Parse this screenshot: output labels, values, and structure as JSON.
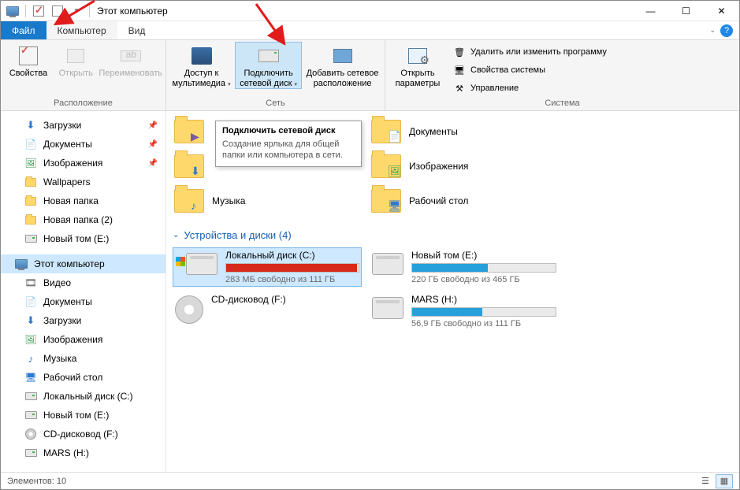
{
  "title": "Этот компьютер",
  "menu": {
    "file": "Файл",
    "computer": "Компьютер",
    "view": "Вид"
  },
  "ribbon": {
    "group_location": "Расположение",
    "location": {
      "properties": "Свойства",
      "open": "Открыть",
      "rename": "Переименовать"
    },
    "group_network": "Сеть",
    "network": {
      "media": "Доступ к мультимедиа",
      "map_drive": "Подключить сетевой диск",
      "add_location": "Добавить сетевое расположение"
    },
    "group_system": "Система",
    "system": {
      "open_params": "Открыть параметры",
      "uninstall": "Удалить или изменить программу",
      "sys_props": "Свойства системы",
      "manage": "Управление"
    }
  },
  "tooltip": {
    "title": "Подключить сетевой диск",
    "body": "Создание ярлыка для общей папки или компьютера в сети."
  },
  "nav": {
    "quick": [
      {
        "label": "Загрузки",
        "icon": "downloads",
        "pinned": true
      },
      {
        "label": "Документы",
        "icon": "documents",
        "pinned": true
      },
      {
        "label": "Изображения",
        "icon": "pictures",
        "pinned": true
      },
      {
        "label": "Wallpapers",
        "icon": "folder",
        "pinned": false
      },
      {
        "label": "Новая папка",
        "icon": "folder",
        "pinned": false
      },
      {
        "label": "Новая папка (2)",
        "icon": "folder",
        "pinned": false
      },
      {
        "label": "Новый том (E:)",
        "icon": "drive",
        "pinned": false
      }
    ],
    "this_pc": "Этот компьютер",
    "pc_children": [
      {
        "label": "Видео",
        "icon": "video"
      },
      {
        "label": "Документы",
        "icon": "documents"
      },
      {
        "label": "Загрузки",
        "icon": "downloads"
      },
      {
        "label": "Изображения",
        "icon": "pictures"
      },
      {
        "label": "Музыка",
        "icon": "music"
      },
      {
        "label": "Рабочий стол",
        "icon": "desktop"
      },
      {
        "label": "Локальный диск (C:)",
        "icon": "drive"
      },
      {
        "label": "Новый том (E:)",
        "icon": "drive"
      },
      {
        "label": "CD-дисковод (F:)",
        "icon": "cd"
      },
      {
        "label": "MARS (H:)",
        "icon": "drive"
      }
    ]
  },
  "folders_section": {
    "items": [
      {
        "label": "Музыка",
        "overlay": "music"
      },
      {
        "label": "Документы",
        "overlay": "documents"
      },
      {
        "label": "Изображения",
        "overlay": "pictures"
      },
      {
        "label": "Рабочий стол",
        "overlay": "desktop"
      }
    ],
    "partial_visible": [
      {
        "label": "",
        "overlay": "video"
      },
      {
        "label": "",
        "overlay": "downloads"
      }
    ]
  },
  "devices_section": {
    "heading": "Устройства и диски (4)",
    "drives": [
      {
        "name": "Локальный диск (C:)",
        "free": "283 МБ свободно из 111 ГБ",
        "fill_pct": 99,
        "color": "#d62a1a",
        "kind": "win",
        "selected": true
      },
      {
        "name": "Новый том (E:)",
        "free": "220 ГБ свободно из 465 ГБ",
        "fill_pct": 53,
        "color": "#26a0da",
        "kind": "hdd"
      },
      {
        "name": "CD-дисковод (F:)",
        "free": "",
        "fill_pct": 0,
        "color": "",
        "kind": "cd"
      },
      {
        "name": "MARS (H:)",
        "free": "56,9 ГБ свободно из 111 ГБ",
        "fill_pct": 49,
        "color": "#26a0da",
        "kind": "hdd"
      }
    ]
  },
  "status": {
    "items": "Элементов: 10"
  }
}
